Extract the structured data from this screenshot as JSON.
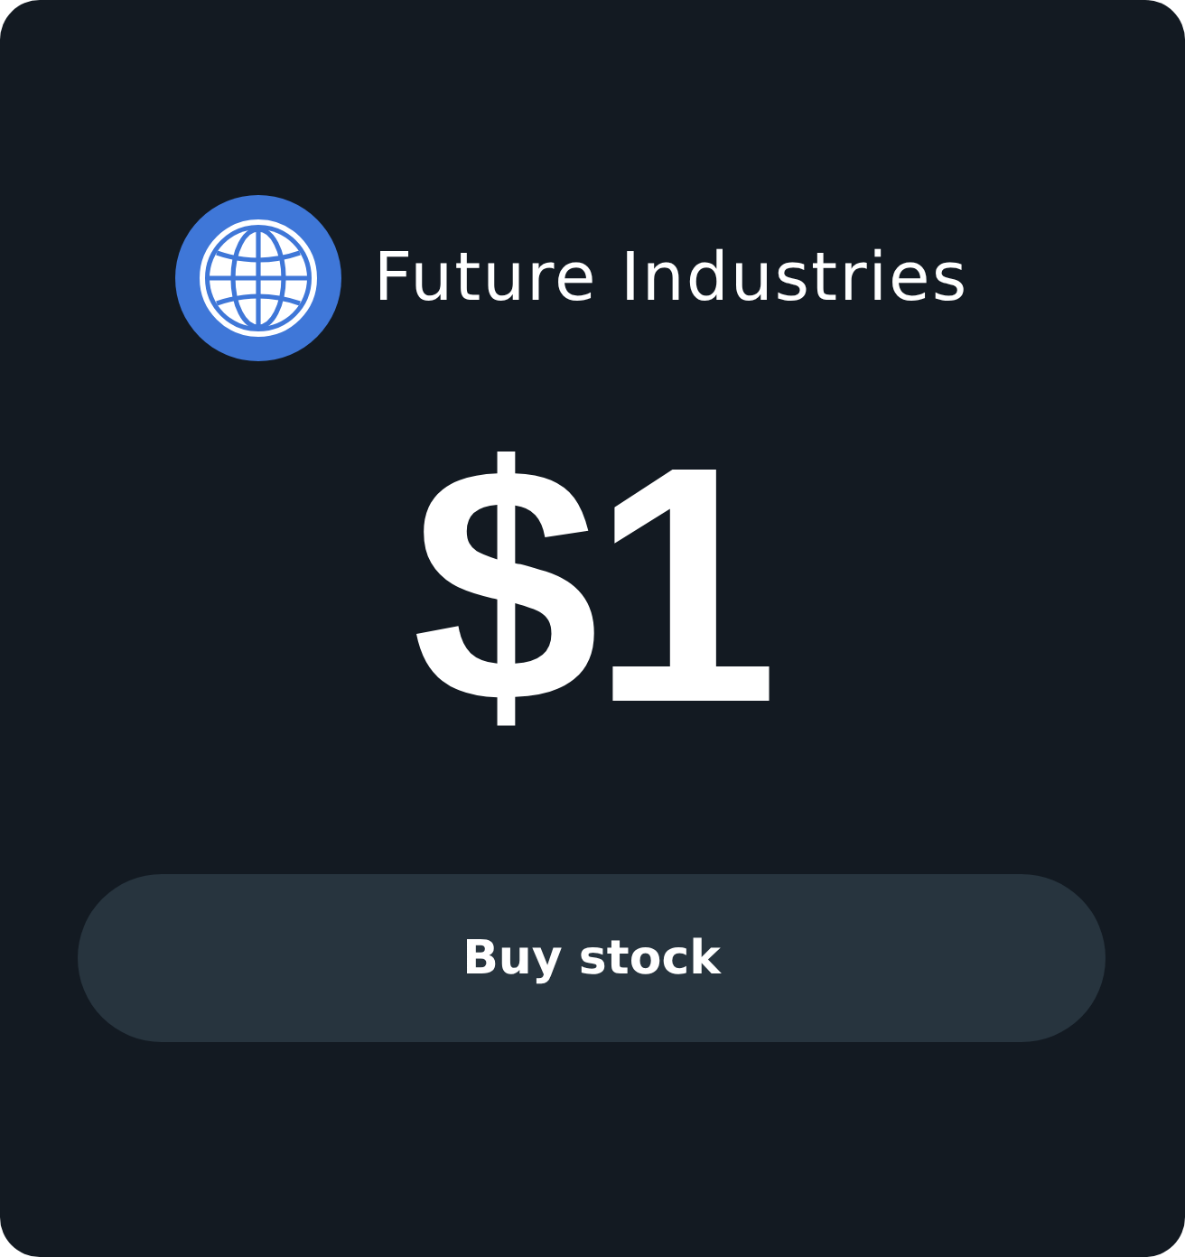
{
  "company": {
    "name": "Future Industries"
  },
  "price": "$1",
  "buttons": [
    {
      "label": "Buy stock"
    }
  ]
}
